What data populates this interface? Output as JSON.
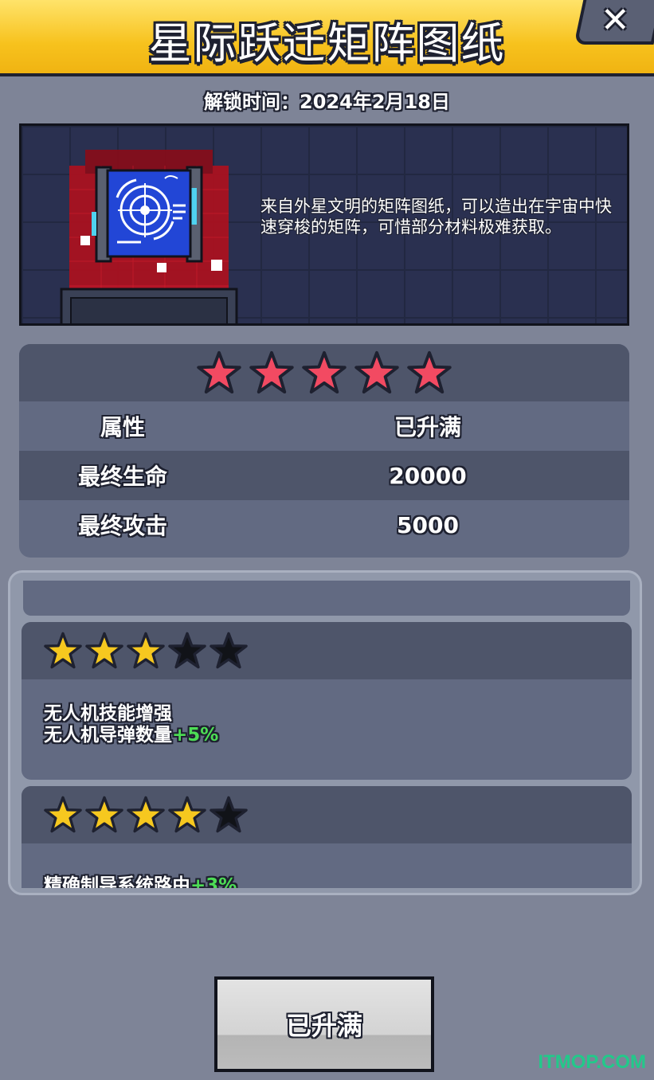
{
  "header": {
    "title": "星际跃迁矩阵图纸",
    "close_label": "✕"
  },
  "unlock_text": "解锁时间：2024年2月18日",
  "item": {
    "description": "来自外星文明的矩阵图纸，可以造出在宇宙中快速穿梭的矩阵，可惜部分材料极难获取。"
  },
  "stats": {
    "star_rating": 5,
    "header": {
      "label": "属性",
      "value": "已升满"
    },
    "rows": [
      {
        "label": "最终生命",
        "value": "20000"
      },
      {
        "label": "最终攻击",
        "value": "5000"
      }
    ]
  },
  "skills": [
    {
      "stars_filled": 3,
      "stars_total": 5,
      "line1": "无人机技能增强",
      "line2": "无人机导弹数量",
      "bonus": "+5%"
    },
    {
      "stars_filled": 4,
      "stars_total": 5,
      "line1": "精确制导系统路由",
      "bonus": "+3%"
    }
  ],
  "button": {
    "label": "已升满"
  },
  "watermark": "ITMOP.COM",
  "colors": {
    "header_yellow": "#f7c21d",
    "bonus_green": "#4ddd55",
    "star_pink": "#f24a62",
    "star_gold": "#f6c81f"
  }
}
